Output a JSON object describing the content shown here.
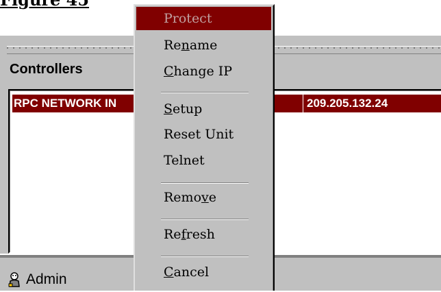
{
  "caption": "Figure 45",
  "window": {
    "heading": "Controllers",
    "rows": [
      {
        "name": "RPC NETWORK IN",
        "ip": "209.205.132.24"
      }
    ]
  },
  "status": {
    "user": "Admin"
  },
  "context_menu": {
    "items": [
      {
        "pre": "",
        "key": "",
        "post": "Protect",
        "highlighted": true
      },
      {
        "pre": "Re",
        "key": "n",
        "post": "ame"
      },
      {
        "pre": "",
        "key": "C",
        "post": "hange IP"
      },
      {
        "pre": "",
        "key": "S",
        "post": "etup"
      },
      {
        "pre": "",
        "key": "",
        "post": "Reset Unit"
      },
      {
        "pre": "",
        "key": "",
        "post": "Telnet"
      },
      {
        "pre": "Remo",
        "key": "v",
        "post": "e"
      },
      {
        "pre": "Re",
        "key": "f",
        "post": "resh"
      },
      {
        "pre": "",
        "key": "C",
        "post": "ancel"
      }
    ]
  },
  "colors": {
    "selection": "#800000",
    "face": "#c0c0c0"
  },
  "icons": {
    "user": "user-icon"
  }
}
